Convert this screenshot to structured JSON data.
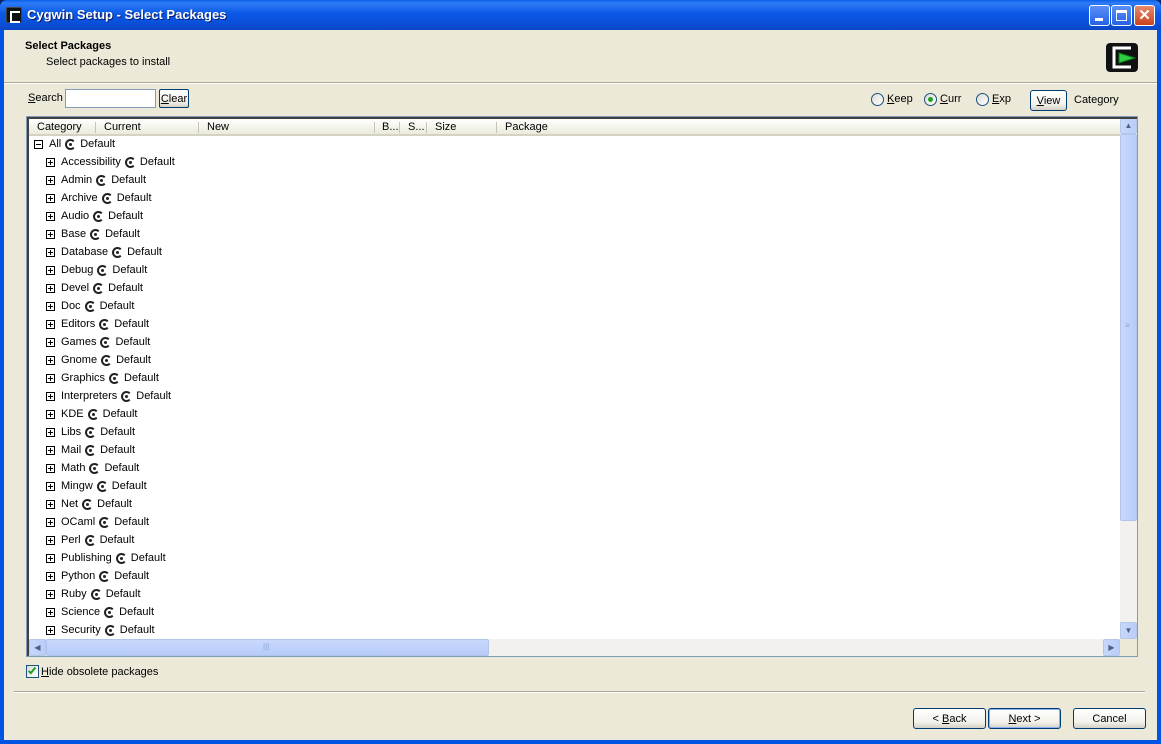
{
  "window": {
    "title": "Cygwin Setup - Select Packages"
  },
  "header": {
    "title": "Select Packages",
    "subtitle": "Select packages to install"
  },
  "search": {
    "label_underlined": "S",
    "label_rest": "earch",
    "value": "",
    "clear_underlined": "C",
    "clear_rest": "lear"
  },
  "view_options": {
    "keep_u": "K",
    "keep_rest": "eep",
    "curr_u": "C",
    "curr_rest": "urr",
    "exp_u": "E",
    "exp_rest": "xp",
    "selected": "Curr",
    "view_u": "V",
    "view_rest": "iew",
    "mode": "Category"
  },
  "columns": [
    "Category",
    "Current",
    "New",
    "B...",
    "S...",
    "Size",
    "Package"
  ],
  "root": {
    "label": "All",
    "value": "Default",
    "expanded": true
  },
  "categories": [
    {
      "label": "Accessibility",
      "value": "Default"
    },
    {
      "label": "Admin",
      "value": "Default"
    },
    {
      "label": "Archive",
      "value": "Default"
    },
    {
      "label": "Audio",
      "value": "Default"
    },
    {
      "label": "Base",
      "value": "Default"
    },
    {
      "label": "Database",
      "value": "Default"
    },
    {
      "label": "Debug",
      "value": "Default"
    },
    {
      "label": "Devel",
      "value": "Default"
    },
    {
      "label": "Doc",
      "value": "Default"
    },
    {
      "label": "Editors",
      "value": "Default"
    },
    {
      "label": "Games",
      "value": "Default"
    },
    {
      "label": "Gnome",
      "value": "Default"
    },
    {
      "label": "Graphics",
      "value": "Default"
    },
    {
      "label": "Interpreters",
      "value": "Default"
    },
    {
      "label": "KDE",
      "value": "Default"
    },
    {
      "label": "Libs",
      "value": "Default"
    },
    {
      "label": "Mail",
      "value": "Default"
    },
    {
      "label": "Math",
      "value": "Default"
    },
    {
      "label": "Mingw",
      "value": "Default"
    },
    {
      "label": "Net",
      "value": "Default"
    },
    {
      "label": "OCaml",
      "value": "Default"
    },
    {
      "label": "Perl",
      "value": "Default"
    },
    {
      "label": "Publishing",
      "value": "Default"
    },
    {
      "label": "Python",
      "value": "Default"
    },
    {
      "label": "Ruby",
      "value": "Default"
    },
    {
      "label": "Science",
      "value": "Default"
    },
    {
      "label": "Security",
      "value": "Default"
    }
  ],
  "hide_obsolete": {
    "u": "H",
    "rest": "ide obsolete packages",
    "checked": true
  },
  "footer": {
    "back_prefix": "< ",
    "back_u": "B",
    "back_rest": "ack",
    "next_u": "N",
    "next_rest": "ext >",
    "cancel": "Cancel"
  }
}
